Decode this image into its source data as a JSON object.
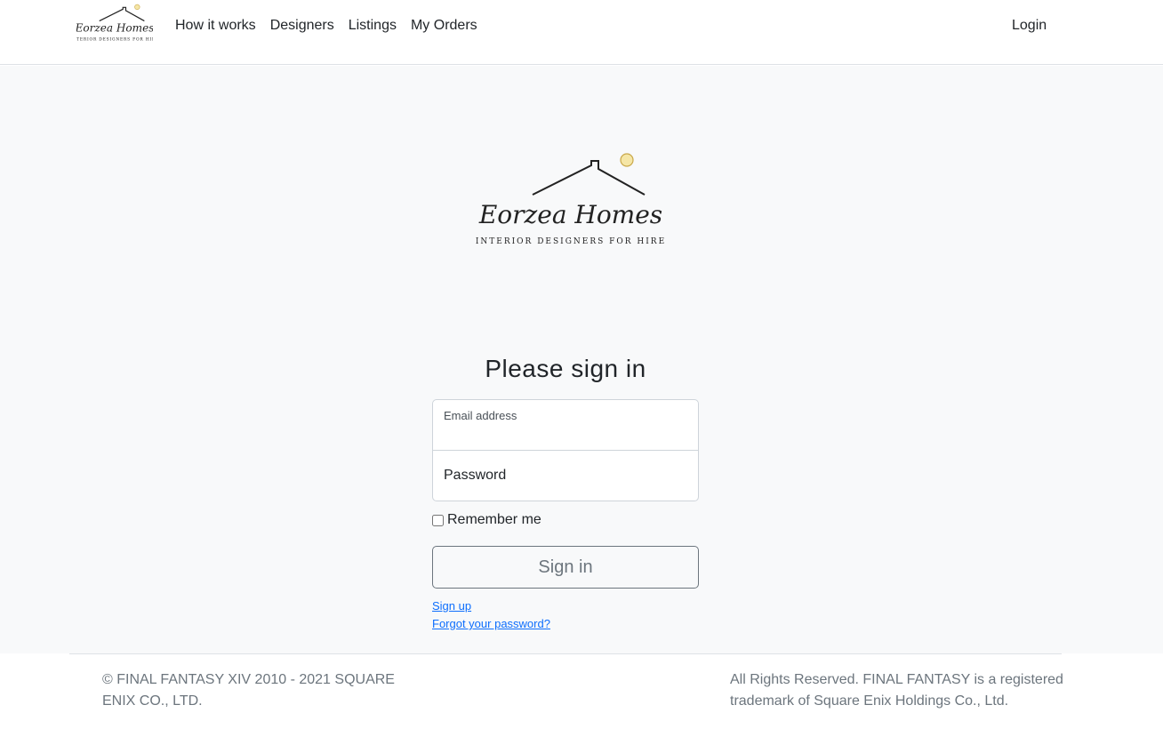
{
  "brand": {
    "logo_script": "Eorzea Homes",
    "logo_tagline": "INTERIOR DESIGNERS FOR HIRE"
  },
  "nav": {
    "links": [
      "How it works",
      "Designers",
      "Listings",
      "My Orders"
    ],
    "login": "Login"
  },
  "form": {
    "title": "Please sign in",
    "email_label": "Email address",
    "email_value": "",
    "password_placeholder": "Password",
    "remember_label": "Remember me",
    "remember_checked": false,
    "submit_label": "Sign in",
    "signup_link": "Sign up",
    "forgot_link": "Forgot your password?"
  },
  "footer": {
    "left": "© FINAL FANTASY XIV 2010 - 2021 SQUARE ENIX CO., LTD.",
    "right": "All Rights Reserved. FINAL FANTASY is a registered trademark of Square Enix Holdings Co., Ltd."
  },
  "colors": {
    "page_bg": "#f8f9fa",
    "link": "#0d6efd",
    "muted": "#6c757d",
    "sun": "#f5e6a6"
  }
}
